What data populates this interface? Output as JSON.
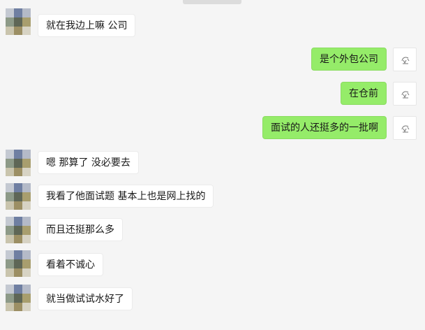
{
  "messages": [
    {
      "side": "left",
      "text": "就在我边上嘛 公司"
    },
    {
      "side": "right",
      "text": "是个外包公司"
    },
    {
      "side": "right",
      "text": "在仓前"
    },
    {
      "side": "right",
      "text": "面试的人还挺多的一批啊"
    },
    {
      "side": "left",
      "text": "嗯 那算了 没必要去"
    },
    {
      "side": "left",
      "text": "我看了他面试题 基本上也是网上找的"
    },
    {
      "side": "left",
      "text": "而且还挺那么多"
    },
    {
      "side": "left",
      "text": "看着不诚心"
    },
    {
      "side": "left",
      "text": "就当做试试水好了"
    }
  ],
  "colors": {
    "background": "#f5f5f5",
    "incoming_bubble": "#ffffff",
    "outgoing_bubble": "#95ec69",
    "text": "#181818"
  },
  "icons": {
    "contact_avatar": "pixelated-avatar-icon",
    "self_avatar": "sketch-avatar-icon"
  }
}
